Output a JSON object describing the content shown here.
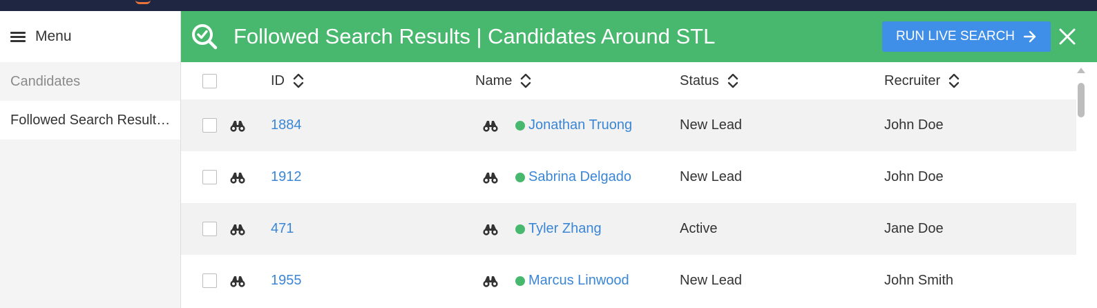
{
  "sidebar": {
    "menu_label": "Menu",
    "items": [
      {
        "label": "Candidates",
        "active": false
      },
      {
        "label": "Followed Search Results | Candidates Around STL",
        "active": true
      }
    ]
  },
  "header": {
    "title": "Followed Search Results | Candidates Around STL",
    "run_button_label": "RUN LIVE SEARCH",
    "accent_color": "#49b86f",
    "button_color": "#3f8ee8"
  },
  "table": {
    "columns": [
      "ID",
      "Name",
      "Status",
      "Recruiter"
    ],
    "rows": [
      {
        "id": "1884",
        "name": "Jonathan Truong",
        "status": "New Lead",
        "recruiter": "John Doe"
      },
      {
        "id": "1912",
        "name": "Sabrina Delgado",
        "status": "New Lead",
        "recruiter": "John Doe"
      },
      {
        "id": "471",
        "name": "Tyler Zhang",
        "status": "Active",
        "recruiter": "Jane Doe"
      },
      {
        "id": "1955",
        "name": "Marcus Linwood",
        "status": "New Lead",
        "recruiter": "John Smith"
      }
    ]
  },
  "icons": {
    "title": "search-check-icon",
    "row_follow": "binoculars-icon",
    "sort": "sort-updown-icon",
    "close": "close-icon",
    "arrow": "arrow-right-icon",
    "menu": "hamburger-icon"
  }
}
